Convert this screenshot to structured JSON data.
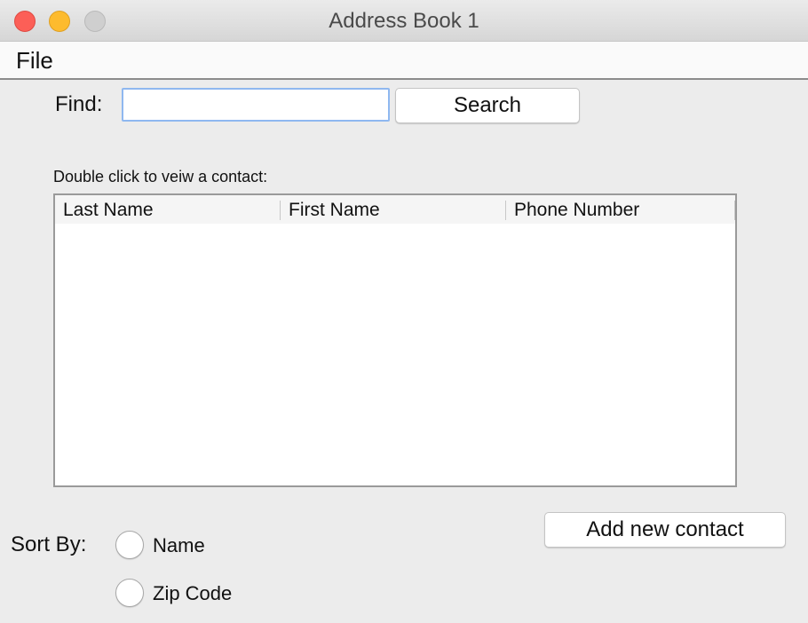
{
  "window": {
    "title": "Address Book 1"
  },
  "menu": {
    "file": "File"
  },
  "find": {
    "label": "Find:",
    "value": "",
    "placeholder": "",
    "button": "Search"
  },
  "hint": "Double click to veiw a contact:",
  "table": {
    "columns": [
      "Last Name",
      "First Name",
      "Phone Number"
    ],
    "rows": []
  },
  "sort": {
    "label": "Sort By:",
    "options": [
      {
        "label": "Name",
        "selected": false
      },
      {
        "label": "Zip Code",
        "selected": false
      }
    ]
  },
  "actions": {
    "add_contact": "Add new contact"
  },
  "colors": {
    "close": "#fc5f57",
    "minimize": "#fdbb2e",
    "maximize": "#cfcfcf",
    "focus_ring": "#8fb8f0"
  }
}
